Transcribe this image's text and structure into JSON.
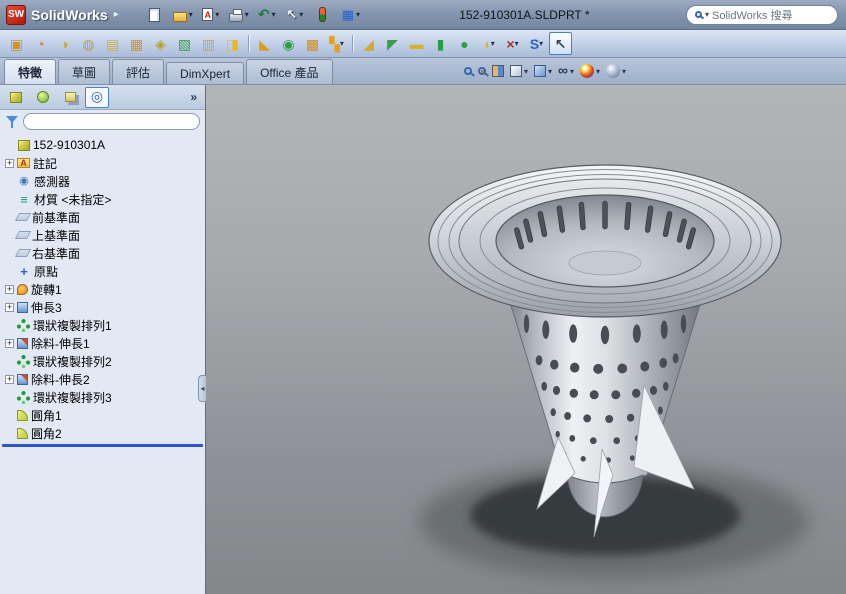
{
  "window": {
    "logo_mark": "SW",
    "app_name": "SolidWorks",
    "document_title": "152-910301A.SLDPRT *",
    "search_placeholder": "SolidWorks 搜尋"
  },
  "title_toolbar": [
    {
      "name": "new-document-icon"
    },
    {
      "name": "open-icon",
      "dropdown": true
    },
    {
      "name": "save-icon",
      "dropdown": true
    },
    {
      "name": "print-icon",
      "dropdown": true
    },
    {
      "name": "undo-icon",
      "dropdown": true
    },
    {
      "name": "select-icon",
      "dropdown": true
    },
    {
      "name": "rebuild-icon"
    },
    {
      "name": "view-settings-icon",
      "dropdown": true
    }
  ],
  "main_toolbar": [
    {
      "name": "tool-icon-1",
      "glyph": "▣",
      "color": "#d89018"
    },
    {
      "name": "tool-icon-2",
      "glyph": "◔",
      "color": "#e07818"
    },
    {
      "name": "tool-icon-3",
      "glyph": "◑",
      "color": "#d8a018"
    },
    {
      "name": "tool-icon-4",
      "glyph": "◍",
      "color": "#c8a020"
    },
    {
      "name": "tool-icon-5",
      "glyph": "▤",
      "color": "#d8b030"
    },
    {
      "name": "tool-icon-6",
      "glyph": "▦",
      "color": "#e09020"
    },
    {
      "name": "tool-icon-7",
      "glyph": "◈",
      "color": "#b8a020"
    },
    {
      "name": "tool-icon-8",
      "glyph": "▧",
      "color": "#38a048"
    },
    {
      "name": "tool-icon-9",
      "glyph": "▥",
      "color": "#d0a828"
    },
    {
      "name": "tool-icon-10",
      "glyph": "◨",
      "color": "#e8b820"
    },
    {
      "sep": true
    },
    {
      "name": "tool-icon-11",
      "glyph": "◣",
      "color": "#d8a018"
    },
    {
      "name": "tool-icon-12",
      "glyph": "◉",
      "color": "#28a038"
    },
    {
      "name": "tool-icon-13",
      "glyph": "▩",
      "color": "#d89018"
    },
    {
      "name": "tool-icon-14",
      "glyph": "▚",
      "color": "#e8a010",
      "dropdown": true
    },
    {
      "sep": true
    },
    {
      "name": "tool-icon-15",
      "glyph": "◢",
      "color": "#d8a830"
    },
    {
      "name": "tool-icon-16",
      "glyph": "◤",
      "color": "#38a048"
    },
    {
      "name": "tool-icon-17",
      "glyph": "▬",
      "color": "#d8b030"
    },
    {
      "name": "tool-icon-18",
      "glyph": "▮",
      "color": "#28a048"
    },
    {
      "name": "tool-icon-19",
      "glyph": "●",
      "color": "#30a040"
    },
    {
      "name": "tool-icon-20",
      "glyph": "◖",
      "color": "#e8b020",
      "dropdown": true
    },
    {
      "name": "tool-icon-21",
      "glyph": "×",
      "color": "#b03020",
      "dropdown": true
    },
    {
      "name": "tool-icon-22",
      "glyph": "S",
      "color": "#2a62c8",
      "dropdown": true
    },
    {
      "name": "tool-icon-23",
      "glyph": "↖",
      "color": "#33445a",
      "pressed": true
    }
  ],
  "command_tabs": [
    {
      "name": "tab-features",
      "label": "特徵",
      "active": true
    },
    {
      "name": "tab-sketch",
      "label": "草圖"
    },
    {
      "name": "tab-evaluate",
      "label": "評估"
    },
    {
      "name": "tab-dimxpert",
      "label": "DimXpert"
    },
    {
      "name": "tab-office-products",
      "label": "Office 產品"
    }
  ],
  "view_toolbar": [
    {
      "name": "zoom-fit-icon"
    },
    {
      "name": "zoom-area-icon"
    },
    {
      "name": "section-view-icon"
    },
    {
      "name": "view-orientation-icon",
      "dropdown": true
    },
    {
      "name": "display-style-icon",
      "dropdown": true
    },
    {
      "name": "hide-show-items-icon",
      "dropdown": true
    },
    {
      "name": "edit-appearance-icon",
      "dropdown": true
    },
    {
      "name": "apply-scene-icon",
      "dropdown": true
    }
  ],
  "panel": {
    "tabs": [
      {
        "name": "featuremanager-tab"
      },
      {
        "name": "propertymanager-tab"
      },
      {
        "name": "configurationmanager-tab"
      },
      {
        "name": "dimxpertmanager-tab",
        "active": true
      }
    ],
    "more_label": "»",
    "filter_value": ""
  },
  "tree": {
    "root": {
      "label": "152-910301A",
      "icon": "part-icon"
    },
    "items": [
      {
        "name": "tree-item-annotations",
        "label": "註記",
        "icon": "annotations-folder-icon",
        "expandable": true
      },
      {
        "name": "tree-item-sensors",
        "label": "感測器",
        "icon": "sensors-icon"
      },
      {
        "name": "tree-item-material",
        "label": "材質 <未指定>",
        "icon": "material-icon"
      },
      {
        "name": "tree-item-front-plane",
        "label": "前基準面",
        "icon": "plane-icon"
      },
      {
        "name": "tree-item-top-plane",
        "label": "上基準面",
        "icon": "plane-icon"
      },
      {
        "name": "tree-item-right-plane",
        "label": "右基準面",
        "icon": "plane-icon"
      },
      {
        "name": "tree-item-origin",
        "label": "原點",
        "icon": "origin-icon"
      },
      {
        "name": "tree-item-revolve1",
        "label": "旋轉1",
        "icon": "revolve-icon",
        "expandable": true
      },
      {
        "name": "tree-item-extrude3",
        "label": "伸長3",
        "icon": "extrude-icon",
        "expandable": true
      },
      {
        "name": "tree-item-circular-pattern1",
        "label": "環狀複製排列1",
        "icon": "circular-pattern-icon"
      },
      {
        "name": "tree-item-cut-extrude1",
        "label": "除料-伸長1",
        "icon": "cut-extrude-icon",
        "expandable": true
      },
      {
        "name": "tree-item-circular-pattern2",
        "label": "環狀複製排列2",
        "icon": "circular-pattern-icon"
      },
      {
        "name": "tree-item-cut-extrude2",
        "label": "除料-伸長2",
        "icon": "cut-extrude-icon",
        "expandable": true
      },
      {
        "name": "tree-item-circular-pattern3",
        "label": "環狀複製排列3",
        "icon": "circular-pattern-icon"
      },
      {
        "name": "tree-item-fillet1",
        "label": "圓角1",
        "icon": "fillet-icon"
      },
      {
        "name": "tree-item-fillet2",
        "label": "圓角2",
        "icon": "fillet-icon"
      }
    ]
  },
  "colors": {
    "rollback_bar": "#2a56c6",
    "brand_red": "#c02010",
    "selection_blue": "#4a80c8"
  }
}
